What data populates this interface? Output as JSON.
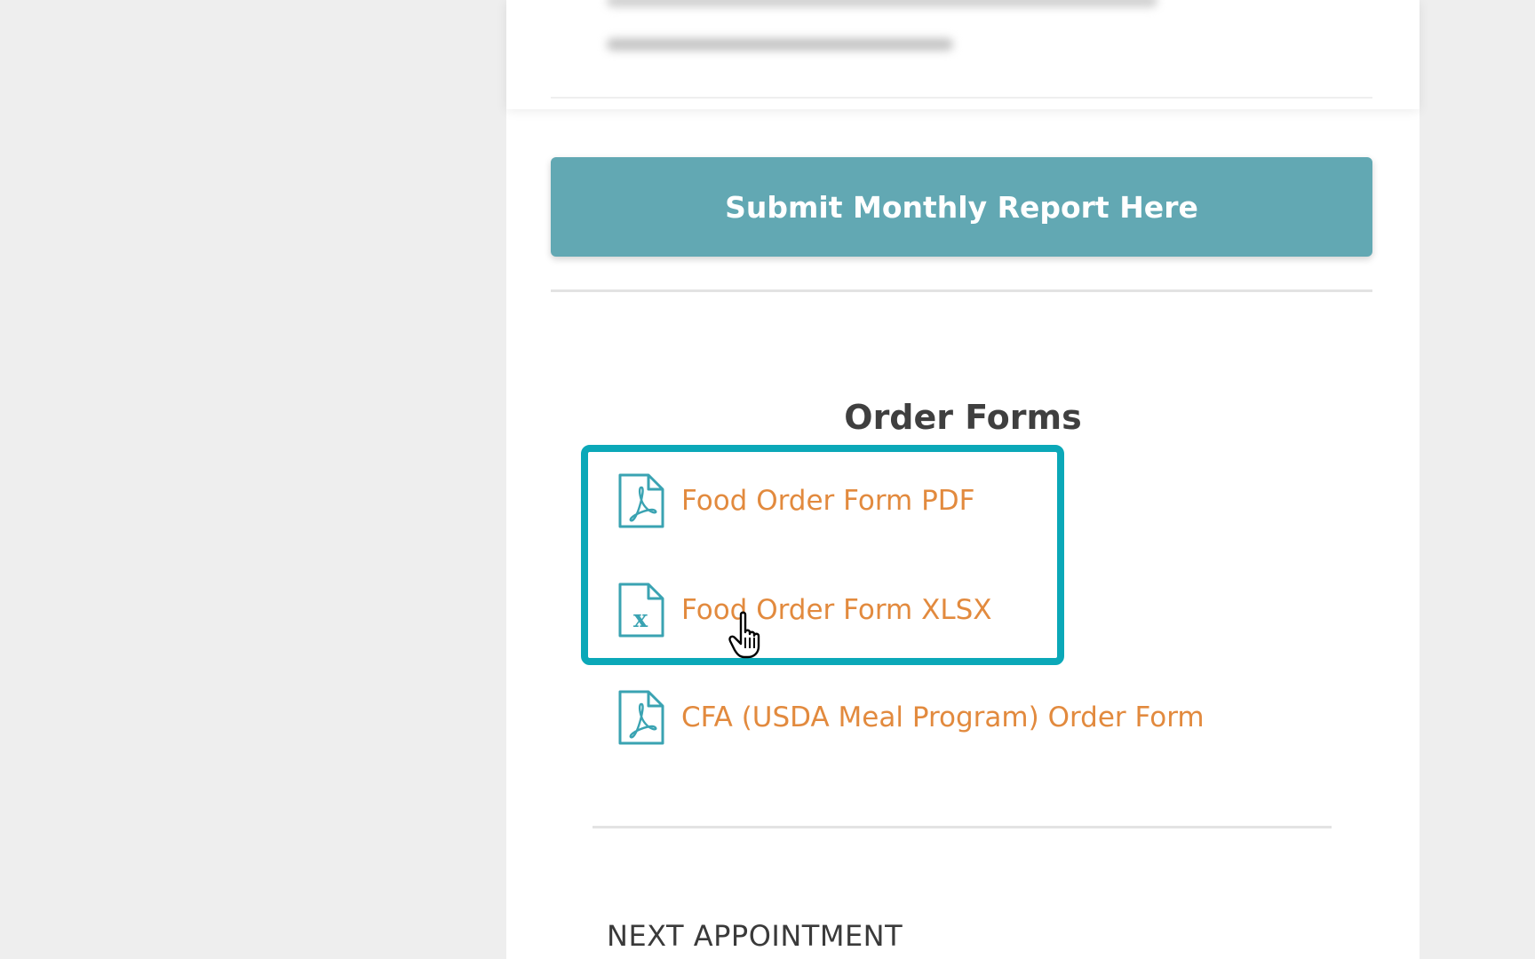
{
  "page": {
    "background_color": "#eeeeee",
    "panel_color": "#ffffff"
  },
  "submit_button": {
    "label": "Submit Monthly Report Here",
    "color": "#62a8b3"
  },
  "order_forms": {
    "title": "Order Forms",
    "link_color": "#e28a3e",
    "icon_color": "#3aa3b2",
    "highlight_color": "#0ba8b8",
    "items": [
      {
        "label": "Food Order Form PDF",
        "icon": "pdf-file-icon"
      },
      {
        "label": "Food Order Form XLSX",
        "icon": "xlsx-file-icon"
      },
      {
        "label": "CFA (USDA Meal Program) Order Form",
        "icon": "pdf-file-icon"
      }
    ]
  },
  "next_appointment": {
    "heading": "NEXT APPOINTMENT"
  },
  "cursor": {
    "icon": "hand-pointer-icon"
  }
}
